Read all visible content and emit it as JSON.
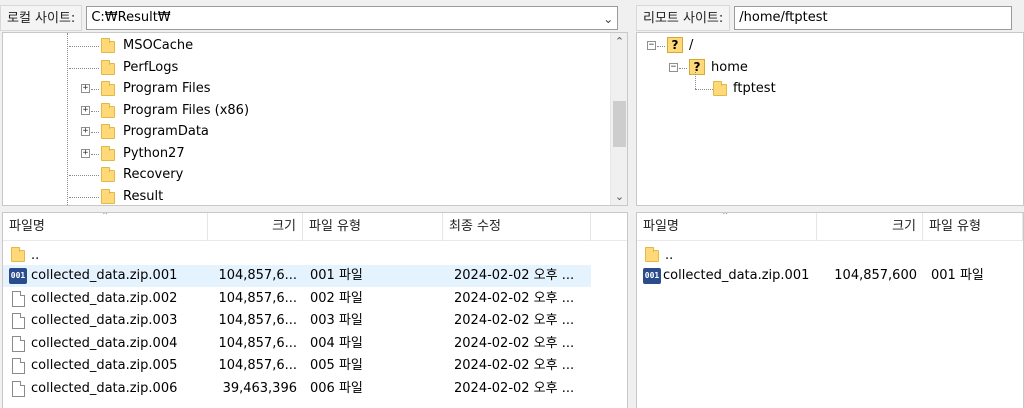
{
  "local_site": {
    "label": "로컬 사이트:",
    "path": "C:₩Result₩",
    "tree": [
      {
        "name": "MSOCache",
        "expandable": false
      },
      {
        "name": "PerfLogs",
        "expandable": false
      },
      {
        "name": "Program Files",
        "expandable": true
      },
      {
        "name": "Program Files (x86)",
        "expandable": true
      },
      {
        "name": "ProgramData",
        "expandable": true
      },
      {
        "name": "Python27",
        "expandable": true
      },
      {
        "name": "Recovery",
        "expandable": false
      },
      {
        "name": "Result",
        "expandable": false
      }
    ]
  },
  "remote_site": {
    "label": "리모트 사이트:",
    "path": "/home/ftptest",
    "tree": [
      {
        "name": "/",
        "icon": "question-folder-icon",
        "expander": "⊟"
      },
      {
        "name": "home",
        "icon": "question-folder-icon",
        "expander": "⊟"
      },
      {
        "name": "ftptest",
        "icon": "folder-icon",
        "expander": ""
      }
    ]
  },
  "local_list": {
    "headers": {
      "name": "파일명",
      "size": "크기",
      "type": "파일 유형",
      "modified": "최종 수정"
    },
    "parent": "..",
    "rows": [
      {
        "name": "collected_data.zip.001",
        "size": "104,857,6...",
        "type": "001 파일",
        "modified": "2024-02-02 오후 ...",
        "icon": "zip-001-icon",
        "icon_text": "001",
        "selected": true
      },
      {
        "name": "collected_data.zip.002",
        "size": "104,857,6...",
        "type": "002 파일",
        "modified": "2024-02-02 오후 ...",
        "icon": "file-icon",
        "selected": false
      },
      {
        "name": "collected_data.zip.003",
        "size": "104,857,6...",
        "type": "003 파일",
        "modified": "2024-02-02 오후 ...",
        "icon": "file-icon",
        "selected": false
      },
      {
        "name": "collected_data.zip.004",
        "size": "104,857,6...",
        "type": "004 파일",
        "modified": "2024-02-02 오후 ...",
        "icon": "file-icon",
        "selected": false
      },
      {
        "name": "collected_data.zip.005",
        "size": "104,857,6...",
        "type": "005 파일",
        "modified": "2024-02-02 오후 ...",
        "icon": "file-icon",
        "selected": false
      },
      {
        "name": "collected_data.zip.006",
        "size": "39,463,396",
        "type": "006 파일",
        "modified": "2024-02-02 오후 ...",
        "icon": "file-icon",
        "selected": false
      }
    ]
  },
  "remote_list": {
    "headers": {
      "name": "파일명",
      "size": "크기",
      "type": "파일 유형"
    },
    "parent": "..",
    "rows": [
      {
        "name": "collected_data.zip.001",
        "size": "104,857,600",
        "type": "001 파일",
        "icon": "zip-001-icon",
        "icon_text": "001"
      }
    ]
  },
  "colors": {
    "selection": "#e5f3ff",
    "folder": "#ffd978",
    "zip_icon": "#2a4c8c"
  }
}
